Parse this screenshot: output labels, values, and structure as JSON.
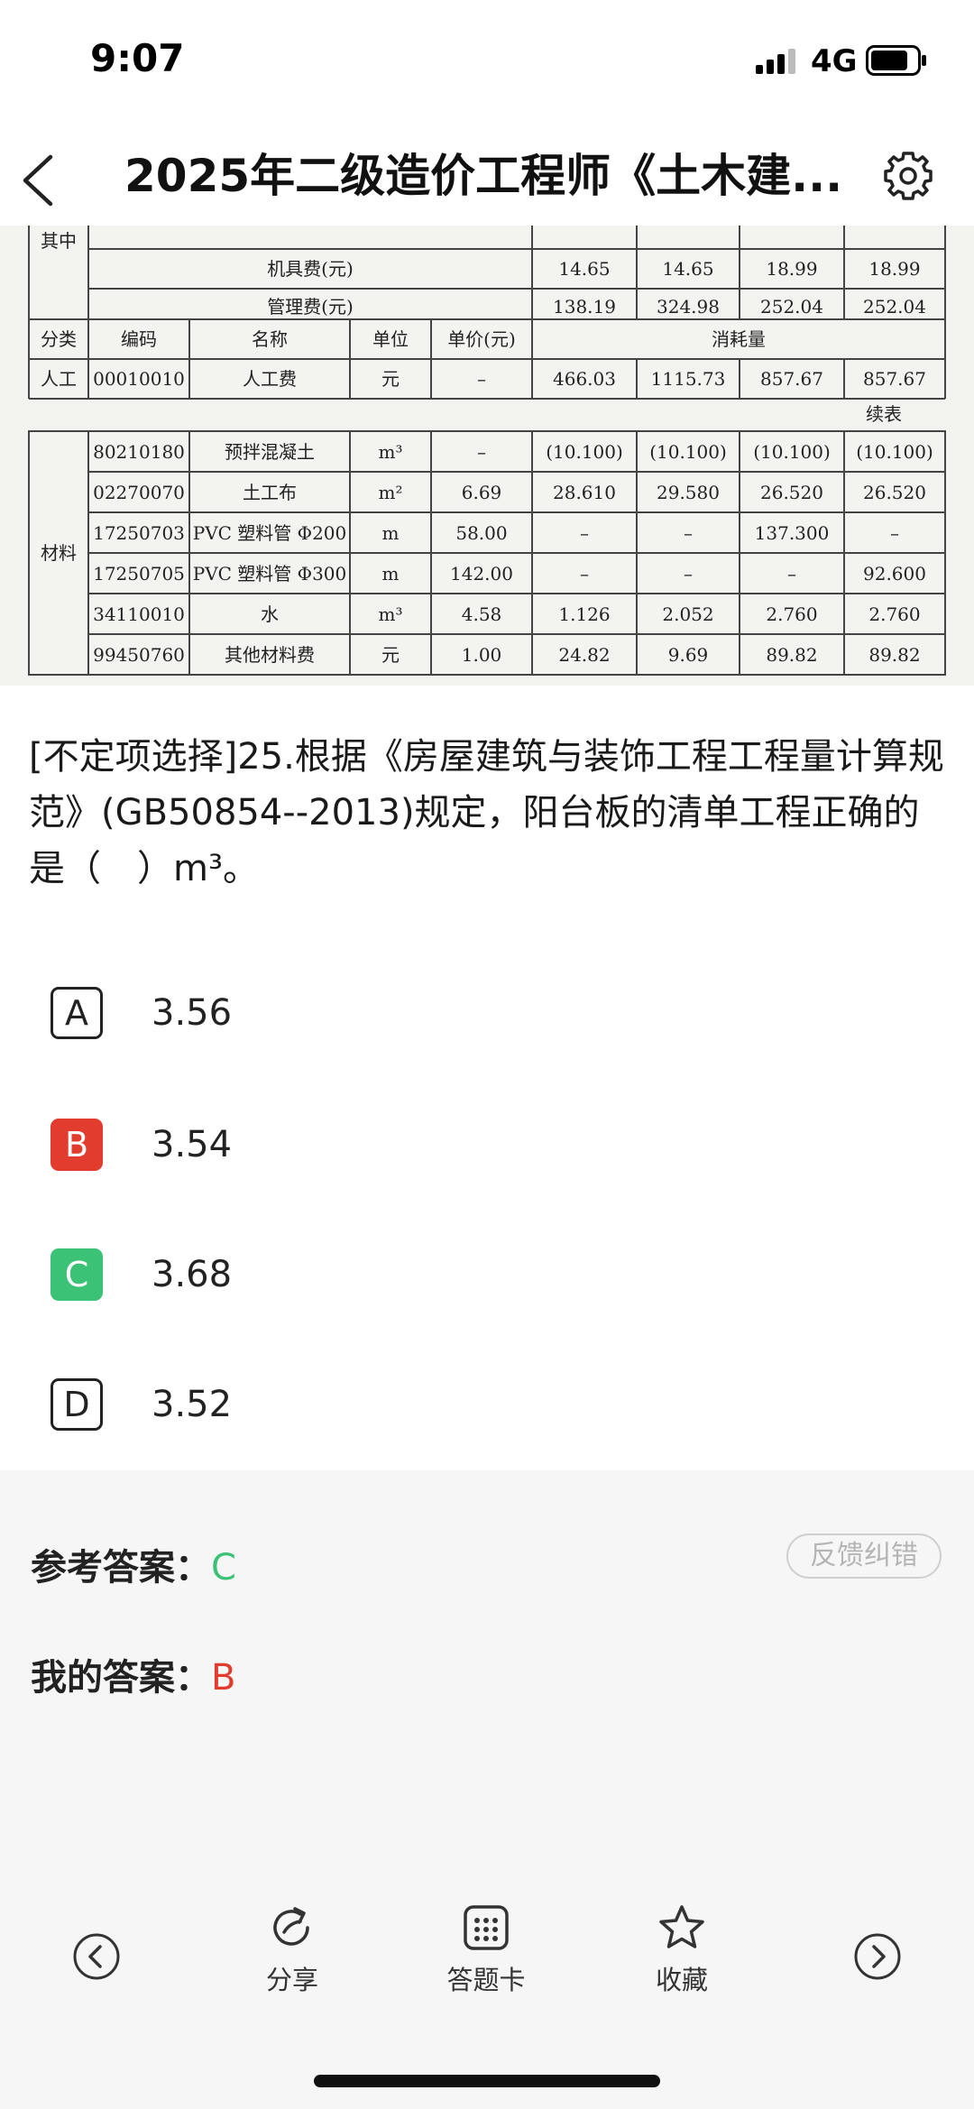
{
  "status_bar": {
    "time": "9:07",
    "network": "4G"
  },
  "nav": {
    "title": "2025年二级造价工程师《土木建..."
  },
  "table": {
    "section_label": "其中",
    "upper_rows": [
      {
        "name": "机具费(元)",
        "values": [
          "14.65",
          "14.65",
          "18.99",
          "18.99"
        ]
      },
      {
        "name": "管理费(元)",
        "values": [
          "138.19",
          "324.98",
          "252.04",
          "252.04"
        ]
      }
    ],
    "headers": [
      "分类",
      "编码",
      "名称",
      "单位",
      "单价(元)",
      "消耗量"
    ],
    "labor_row": {
      "category": "人工",
      "code": "00010010",
      "name": "人工费",
      "unit": "元",
      "price": "–",
      "values": [
        "466.03",
        "1115.73",
        "857.67",
        "857.67"
      ]
    },
    "continued_label": "续表",
    "material_label": "材料",
    "material_rows": [
      {
        "code": "80210180",
        "name": "预拌混凝土",
        "unit": "m³",
        "price": "–",
        "values": [
          "(10.100)",
          "(10.100)",
          "(10.100)",
          "(10.100)"
        ]
      },
      {
        "code": "02270070",
        "name": "土工布",
        "unit": "m²",
        "price": "6.69",
        "values": [
          "28.610",
          "29.580",
          "26.520",
          "26.520"
        ]
      },
      {
        "code": "17250703",
        "name": "PVC 塑料管 Φ200",
        "unit": "m",
        "price": "58.00",
        "values": [
          "–",
          "–",
          "137.300",
          "–"
        ]
      },
      {
        "code": "17250705",
        "name": "PVC 塑料管 Φ300",
        "unit": "m",
        "price": "142.00",
        "values": [
          "–",
          "–",
          "–",
          "92.600"
        ]
      },
      {
        "code": "34110010",
        "name": "水",
        "unit": "m³",
        "price": "4.58",
        "values": [
          "1.126",
          "2.052",
          "2.760",
          "2.760"
        ]
      },
      {
        "code": "99450760",
        "name": "其他材料费",
        "unit": "元",
        "price": "1.00",
        "values": [
          "24.82",
          "9.69",
          "89.82",
          "89.82"
        ]
      }
    ]
  },
  "question": {
    "text": "[不定项选择]25.根据《房屋建筑与装饰工程工程量计算规范》(GB50854--2013)规定，阳台板的清单工程正确的是（　）m³。"
  },
  "options": [
    {
      "letter": "A",
      "text": "3.56",
      "state": "none"
    },
    {
      "letter": "B",
      "text": "3.54",
      "state": "wrong"
    },
    {
      "letter": "C",
      "text": "3.68",
      "state": "right"
    },
    {
      "letter": "D",
      "text": "3.52",
      "state": "none"
    }
  ],
  "answers": {
    "feedback_label": "反馈纠错",
    "reference_label": "参考答案：",
    "reference_value": "C",
    "mine_label": "我的答案：",
    "mine_value": "B"
  },
  "toolbar": {
    "share_label": "分享",
    "answer_card_label": "答题卡",
    "favorite_label": "收藏"
  },
  "colors": {
    "correct": "#3cc277",
    "wrong": "#e23c2f"
  },
  "icons": [
    "chevron-left-icon",
    "gear-icon",
    "prev-circle-icon",
    "share-icon",
    "answer-card-icon",
    "star-icon",
    "next-circle-icon"
  ]
}
